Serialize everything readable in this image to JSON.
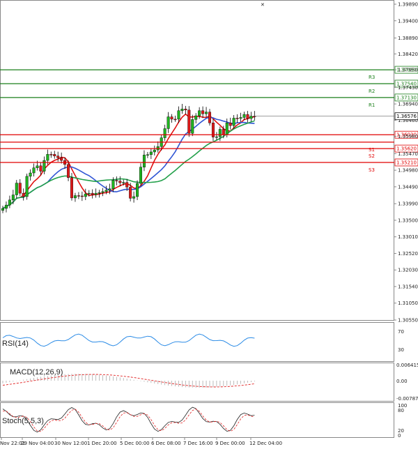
{
  "chart_data": {
    "type": "candlestick",
    "price_axis": {
      "ticks": [
        "1.39890",
        "1.39400",
        "1.38890",
        "1.38420",
        "1.37950",
        "1.37430",
        "1.36940",
        "1.36460",
        "1.35980",
        "1.35470",
        "1.34980",
        "1.34490",
        "1.33990",
        "1.33500",
        "1.33010",
        "1.32520",
        "1.32030",
        "1.31540",
        "1.31050",
        "1.30550"
      ],
      "ylim": [
        1.3055,
        1.3989
      ]
    },
    "current_price": "1.36576",
    "levels": [
      {
        "label": "R3",
        "value": "1.37950",
        "price": 1.3795,
        "color": "#1a7f1a"
      },
      {
        "label": "R2",
        "value": "1.37540",
        "price": 1.3754,
        "color": "#1a7f1a"
      },
      {
        "label": "R1",
        "value": "1.37130",
        "price": 1.3713,
        "color": "#1a7f1a"
      },
      {
        "label": "",
        "value": "1.36030",
        "price": 1.3603,
        "color": "#e00000"
      },
      {
        "label": "S1",
        "value": "",
        "price": 1.3581,
        "color": "#e00000"
      },
      {
        "label": "S2",
        "value": "1.35620",
        "price": 1.3562,
        "color": "#e00000"
      },
      {
        "label": "S3",
        "value": "1.35210",
        "price": 1.3521,
        "color": "#e00000"
      }
    ],
    "time_labels": [
      "Nov 22:01",
      "29 Nov 04:00",
      "30 Nov 12:00",
      "1 Dec 20:00",
      "5 Dec 00:00",
      "6 Dec 08:00",
      "7 Dec 16:00",
      "9 Dec 00:00",
      "12 Dec 04:00"
    ],
    "candles_close": [
      1.3385,
      1.3395,
      1.341,
      1.3425,
      1.346,
      1.343,
      1.342,
      1.348,
      1.349,
      1.3505,
      1.3511,
      1.3495,
      1.3527,
      1.3545,
      1.3545,
      1.354,
      1.3535,
      1.3527,
      1.3515,
      1.3476,
      1.3416,
      1.3423,
      1.3422,
      1.342,
      1.3428,
      1.343,
      1.3426,
      1.343,
      1.3432,
      1.3435,
      1.3439,
      1.3443,
      1.3468,
      1.3466,
      1.3461,
      1.3462,
      1.3448,
      1.3415,
      1.342,
      1.3459,
      1.3507,
      1.3543,
      1.3544,
      1.3552,
      1.3558,
      1.3568,
      1.3594,
      1.3621,
      1.3656,
      1.3649,
      1.3649,
      1.3674,
      1.3679,
      1.3676,
      1.3607,
      1.3648,
      1.3659,
      1.3674,
      1.3665,
      1.367,
      1.3638,
      1.3596,
      1.3597,
      1.3619,
      1.3603,
      1.3638,
      1.363,
      1.3652,
      1.3651,
      1.3654,
      1.3663,
      1.3651,
      1.3658,
      1.3658
    ],
    "candles_up": [
      true,
      true,
      true,
      true,
      true,
      false,
      false,
      true,
      true,
      true,
      true,
      false,
      true,
      true,
      false,
      false,
      false,
      false,
      false,
      false,
      false,
      true,
      false,
      false,
      true,
      true,
      false,
      true,
      true,
      true,
      true,
      true,
      true,
      false,
      false,
      true,
      false,
      false,
      true,
      true,
      true,
      true,
      true,
      true,
      true,
      true,
      true,
      true,
      true,
      false,
      false,
      true,
      true,
      false,
      false,
      true,
      true,
      true,
      false,
      true,
      false,
      false,
      true,
      true,
      false,
      true,
      false,
      true,
      false,
      true,
      true,
      false,
      true,
      false
    ],
    "moving_averages": [
      {
        "color": "#e01010"
      },
      {
        "color": "#2f55d4"
      },
      {
        "color": "#22a04a"
      }
    ],
    "rsi": {
      "label": "RSI(14)",
      "ticks": [
        "100",
        "70",
        "30",
        "0"
      ]
    },
    "macd": {
      "label": "MACD(12,26,9)",
      "ticks": [
        "0.006415",
        "0.00",
        "-0.007877"
      ]
    },
    "stoch": {
      "label": "Stoch(5,5,3)",
      "ticks": [
        "100",
        "80",
        "20",
        "0"
      ]
    }
  }
}
